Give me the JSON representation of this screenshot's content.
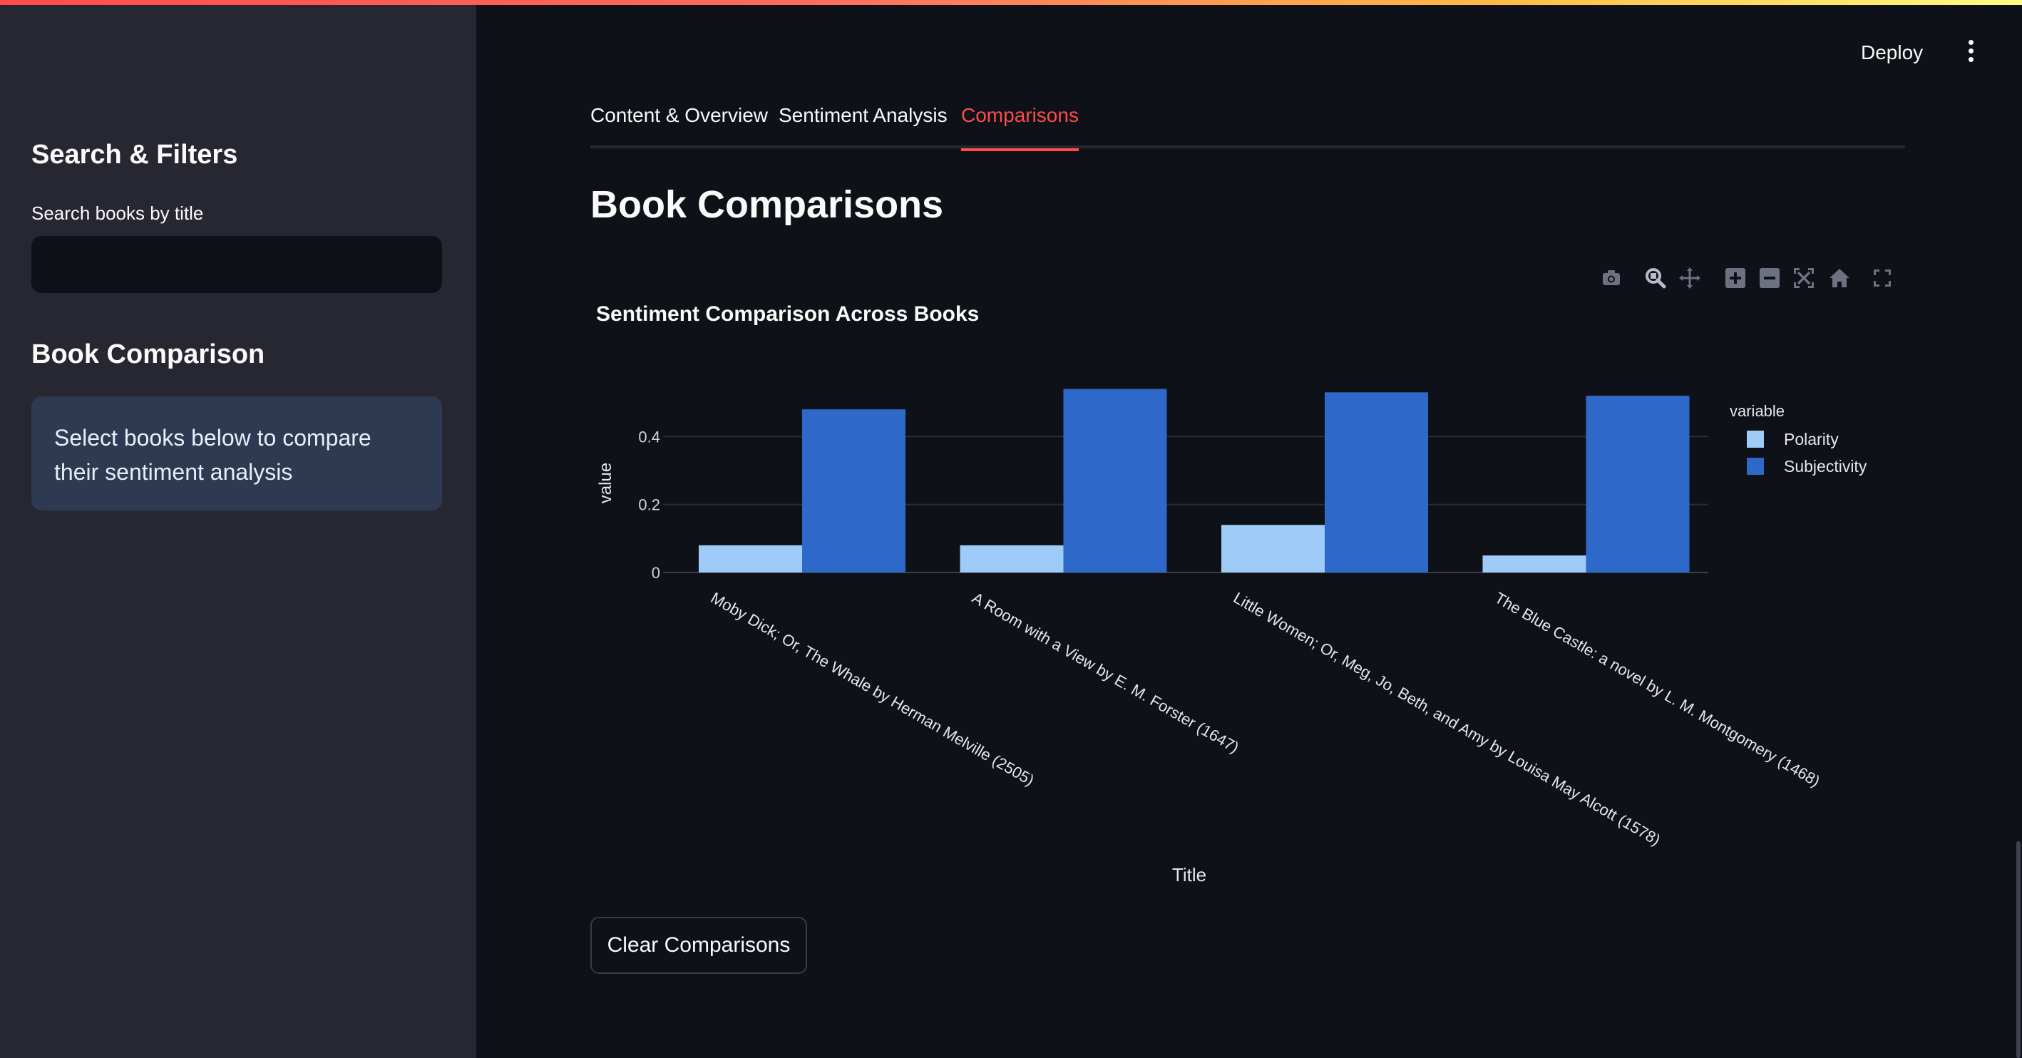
{
  "sidebar": {
    "search_heading": "Search & Filters",
    "search_label": "Search books by title",
    "search_value": "",
    "comparison_heading": "Book Comparison",
    "info_text": "Select books below to compare their sentiment analysis"
  },
  "header": {
    "deploy_label": "Deploy"
  },
  "tabs": [
    {
      "label": "Content & Overview"
    },
    {
      "label": "Sentiment Analysis"
    },
    {
      "label": "Comparisons"
    }
  ],
  "main": {
    "title": "Book Comparisons",
    "clear_button": "Clear Comparisons"
  },
  "colors": {
    "accent": "#ff4b4b",
    "polarity": "#9ecbf7",
    "subjectivity": "#2e68c8"
  },
  "modebar_icons": [
    "camera-icon",
    "zoom-icon",
    "pan-icon",
    "zoom-in-icon",
    "zoom-out-icon",
    "autoscale-icon",
    "reset-axes-icon",
    "fullscreen-icon"
  ],
  "chart_data": {
    "type": "bar",
    "title": "Sentiment Comparison Across Books",
    "xlabel": "Title",
    "ylabel": "value",
    "legend_title": "variable",
    "legend_position": "top-right",
    "categories": [
      "Moby Dick; Or, The Whale by Herman Melville (2505)",
      "A Room with a View by E. M.  Forster (1647)",
      "Little Women; Or, Meg, Jo, Beth, and Amy by Louisa May Alcott (1578)",
      "The Blue Castle: a novel by L. M.  Montgomery (1468)"
    ],
    "series": [
      {
        "name": "Polarity",
        "values": [
          0.08,
          0.08,
          0.14,
          0.05
        ]
      },
      {
        "name": "Subjectivity",
        "values": [
          0.48,
          0.54,
          0.53,
          0.52
        ]
      }
    ],
    "yticks": [
      0,
      0.2,
      0.4
    ],
    "ylim": [
      0,
      0.56
    ],
    "grid": true
  }
}
